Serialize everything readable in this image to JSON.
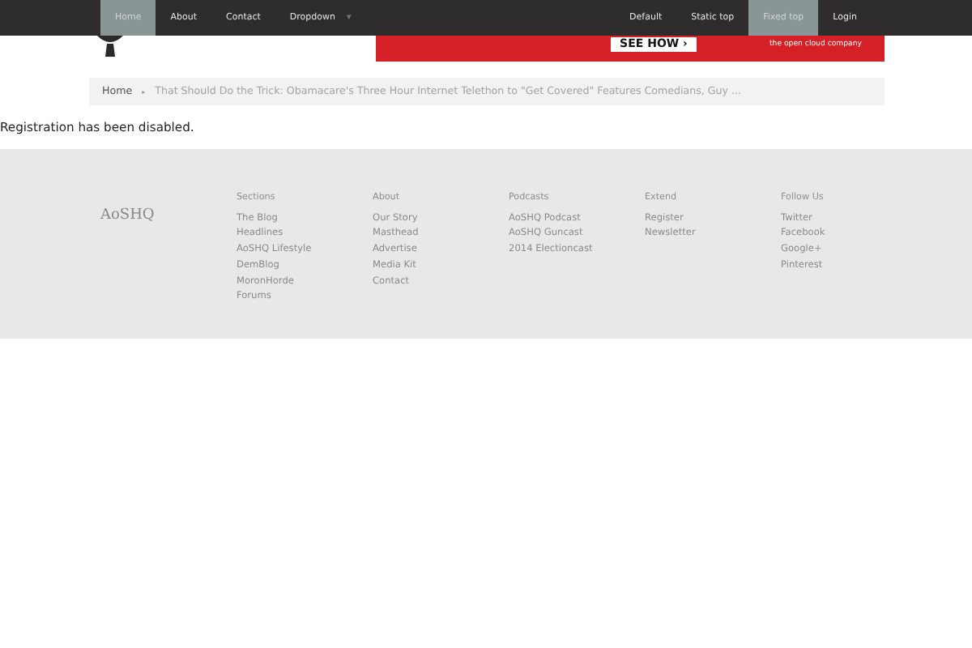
{
  "navbar": {
    "left": [
      {
        "label": "Home",
        "selected": true
      },
      {
        "label": "About",
        "selected": false
      },
      {
        "label": "Contact",
        "selected": false
      },
      {
        "label": "Dropdown",
        "selected": false,
        "caret": "▾"
      }
    ],
    "right": [
      {
        "label": "Default",
        "selected": false
      },
      {
        "label": "Static top",
        "selected": false
      },
      {
        "label": "Fixed top",
        "selected": true
      },
      {
        "label": "Login",
        "selected": false
      }
    ]
  },
  "ad": {
    "button": "SEE HOW ›",
    "tagline": "the open cloud company"
  },
  "breadcrumb": {
    "home": "Home",
    "separator": "▸",
    "current": "That Should Do the Trick: Obamacare's Three Hour Internet Telethon to \"Get Covered\" Features Comedians, Guy ..."
  },
  "message": "Registration has been disabled.",
  "footer": {
    "logo": "AoSHQ",
    "columns": [
      {
        "heading": "Sections",
        "links": [
          "The Blog",
          "Headlines",
          "AoSHQ Lifestyle",
          "DemBlog",
          "MoronHorde",
          "Forums"
        ]
      },
      {
        "heading": "About",
        "links": [
          "Our Story",
          "Masthead",
          "Advertise",
          "Media Kit",
          "Contact"
        ]
      },
      {
        "heading": "Podcasts",
        "links": [
          "AoSHQ Podcast",
          "AoSHQ Guncast",
          "2014 Electioncast"
        ]
      },
      {
        "heading": "Extend",
        "links": [
          "Register",
          "Newsletter"
        ]
      },
      {
        "heading": "Follow Us",
        "links": [
          "Twitter",
          "Facebook",
          "Google+",
          "Pinterest"
        ]
      }
    ]
  }
}
